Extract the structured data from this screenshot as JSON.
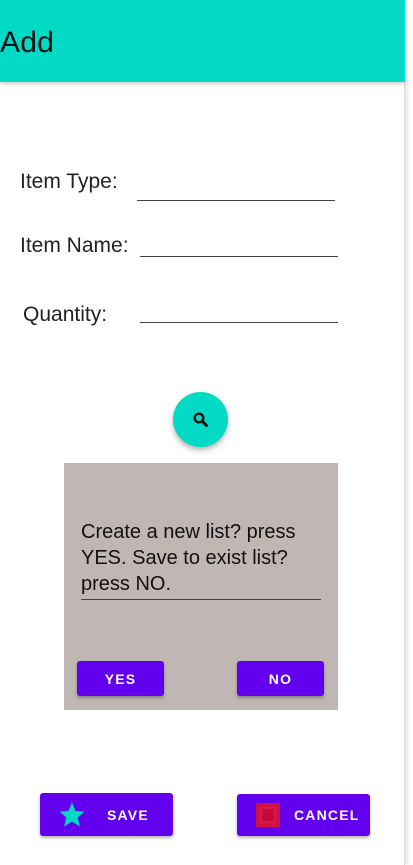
{
  "app_bar": {
    "title": "Add",
    "color": "#03dac5"
  },
  "form": {
    "item_type": {
      "label": "Item Type:",
      "value": ""
    },
    "item_name": {
      "label": "Item Name:",
      "value": ""
    },
    "quantity": {
      "label": "Quantity:",
      "value": ""
    }
  },
  "search_fab": {
    "icon": "search-icon",
    "color": "#03dac5"
  },
  "dialog": {
    "message": "Create a new list? press YES. Save to exist list? press NO.",
    "yes_label": "YES",
    "no_label": "NO",
    "background": "#c0b6b3"
  },
  "actions": {
    "save_label": "SAVE",
    "save_icon": "star-icon",
    "cancel_label": "CANCEL",
    "cancel_icon": "stop-square-icon",
    "button_color": "#6200ee"
  }
}
